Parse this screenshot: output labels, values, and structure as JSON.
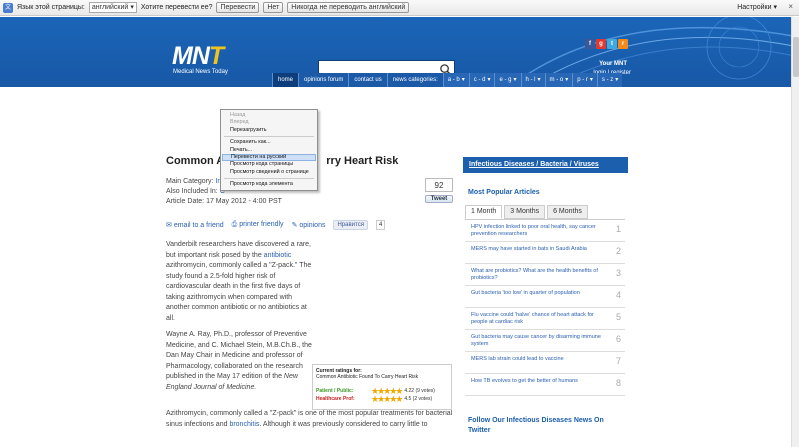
{
  "translate_bar": {
    "label": "Язык этой страницы:",
    "language": "английский",
    "question": "Хотите перевести ее?",
    "translate_btn": "Перевести",
    "no_btn": "Нет",
    "never_btn": "Никогда не переводить английский",
    "settings": "Настройки",
    "close": "×"
  },
  "header": {
    "logo_main": "MN",
    "logo_t": "T",
    "logo_sub": "Medical News Today",
    "search_placeholder": "",
    "your_mnt": "Your MNT",
    "login_register": "login | register"
  },
  "nav": {
    "items": [
      "home",
      "opinions forum",
      "contact us",
      "news categories:"
    ],
    "categories": [
      "a - b",
      "c - d",
      "e - g",
      "h - l",
      "m - o",
      "p - r",
      "s - z"
    ]
  },
  "article": {
    "title_visible_left": "Common A",
    "title_visible_right": "rry Heart Risk",
    "main_category_label": "Main Category:",
    "main_category_value": "In",
    "main_category_tail": "ses",
    "also_included_label": "Also Included In:",
    "also_included_value": "C",
    "article_date": "Article Date: 17 May 2012 - 4:00 PST",
    "share_count": "92",
    "tweet": "Tweet",
    "email": "email to a friend",
    "printer": "printer friendly",
    "opinions": "opinions",
    "fb_like": "Нравится",
    "fb_count": "4",
    "p1_a": "Vanderbilt researchers have discovered a rare, but important risk posed by the",
    "p1_link": "antibiotic",
    "p1_b": "azithromycin, commonly called a \"Z-pack.\" The study found a 2.5-fold higher risk of cardiovascular death in the first five days of taking azithromycin when compared with another common antibiotic or no antibiotics at all.",
    "p2_a": "Wayne A. Ray, Ph.D., professor of Preventive Medicine, and C. Michael Stein, M.B.Ch.B., the Dan May Chair in Medicine and professor of Pharmacology, collaborated on the research published in the May 17 edition of the",
    "p2_em": "New England Journal of Medicine.",
    "p3_a": "Azithromycin, commonly called a \"Z-pack\" is one of the most popular treatments for bacterial sinus infections and",
    "p3_link": "bronchitis",
    "p3_b": ". Although it was previously considered to carry little to"
  },
  "ratings": {
    "title": "Current ratings for:",
    "subject": "Common Antibiotic Found To Carry Heart Risk",
    "patient_label": "Patient / Public:",
    "patient_value": "4.22 (9 votes)",
    "prof_label": "Healthcare Prof:",
    "prof_value": "4.5 (2 votes)"
  },
  "sidebar": {
    "section_bar": "Infectious Diseases / Bacteria / Viruses",
    "popular_heading": "Most Popular Articles",
    "tabs": [
      "1 Month",
      "3 Months",
      "6 Months"
    ],
    "articles": [
      {
        "text": "HPV infection linked to poor oral health, say cancer prevention researchers",
        "num": "1"
      },
      {
        "text": "MERS may have started in bats in Saudi Arabia",
        "num": "2"
      },
      {
        "text": "What are probiotics? What are the health benefits of probiotics?",
        "num": "3"
      },
      {
        "text": "Gut bacteria 'too low' in quarter of population",
        "num": "4"
      },
      {
        "text": "Flu vaccine could 'halve' chance of heart attack for people at cardiac risk",
        "num": "5"
      },
      {
        "text": "Gut bacteria may cause cancer by disarming immune system",
        "num": "6"
      },
      {
        "text": "MERS lab strain could lead to vaccine",
        "num": "7"
      },
      {
        "text": "How TB evolves to get the better of humans",
        "num": "8"
      }
    ],
    "follow_a": "Follow Our ",
    "follow_link": "Infectious Diseases",
    "follow_b": " News On Twitter"
  },
  "context_menu": {
    "items": [
      {
        "label": "Назад",
        "disabled": true
      },
      {
        "label": "Вперед",
        "disabled": true
      },
      {
        "label": "Перезагрузить",
        "disabled": false
      },
      {
        "sep": true
      },
      {
        "label": "Сохранить как...",
        "disabled": false
      },
      {
        "label": "Печать...",
        "disabled": false
      },
      {
        "label": "Перевести на русский",
        "disabled": false,
        "highlight": true
      },
      {
        "label": "Просмотр кода страницы",
        "disabled": false
      },
      {
        "label": "Просмотр сведений о странице",
        "disabled": false
      },
      {
        "sep": true
      },
      {
        "label": "Просмотр кода элемента",
        "disabled": false
      }
    ]
  },
  "colors": {
    "header_blue": "#1b65b8",
    "logo_accent": "#f0c21e",
    "link_blue": "#2a5fb0"
  }
}
